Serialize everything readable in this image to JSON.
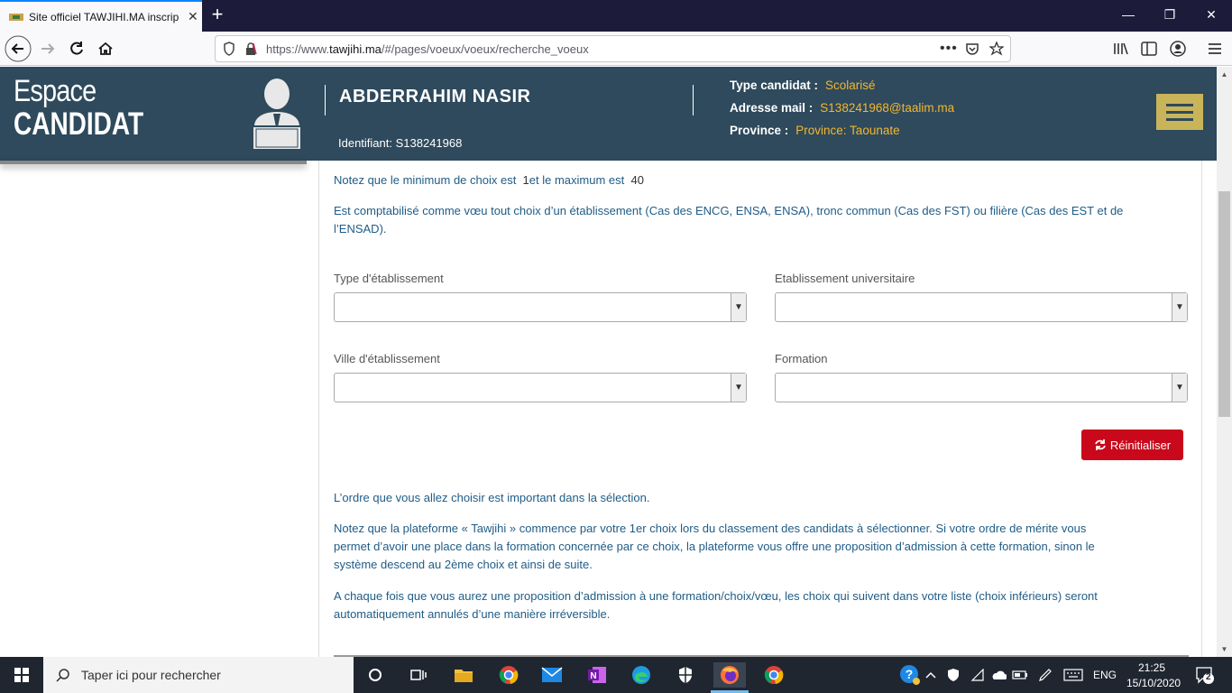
{
  "browser": {
    "tab_title": "Site officiel TAWJIHI.MA inscrip",
    "url_prefix": "https://www.",
    "url_host": "tawjihi.ma",
    "url_path": "/#/pages/voeux/voeux/recherche_voeux"
  },
  "header": {
    "brand_line1": "Espace",
    "brand_line2": "CANDIDAT",
    "candidate_name": "ABDERRAHIM NASIR",
    "identifier": "Identifiant: S138241968",
    "type_label": "Type candidat :",
    "type_value": "Scolarisé",
    "email_label": "Adresse mail :",
    "email_value": "S138241968@taalim.ma",
    "province_label": "Province :",
    "province_value": "Province: Taounate"
  },
  "content": {
    "note_min_max_prefix": "Notez que le minimum de choix est",
    "min_value": "1",
    "note_min_max_mid": "et le maximum est",
    "max_value": "40",
    "comptabilise_line1": "Est comptabilisé comme vœu tout choix d’un établissement (Cas des ENCG, ENSA, ENSA), tronc commun (Cas des FST) ou filière (Cas des EST et de",
    "comptabilise_line2": "l’ENSAD).",
    "label_type": "Type d'établissement",
    "label_etab": "Etablissement universitaire",
    "label_ville": "Ville d'établissement",
    "label_formation": "Formation",
    "reset_button": "Réinitialiser",
    "ordre": "L’ordre que vous allez choisir est important dans la sélection.",
    "plateforme_line1": "Notez que la plateforme « Tawjihi » commence par votre 1er choix lors du classement des candidats à sélectionner. Si votre ordre de mérite vous",
    "plateforme_line2": "permet d’avoir une place dans la formation concernée par ce choix, la plateforme vous offre une proposition d’admission à cette formation, sinon le",
    "plateforme_line3": "système descend au 2ème choix et ainsi de suite.",
    "chaque_line1": "A chaque fois que vous aurez une proposition d’admission à une formation/choix/vœu, les choix qui suivent dans votre liste (choix inférieurs) seront",
    "chaque_line2": "automatiquement annulés d’une manière irréversible."
  },
  "taskbar": {
    "search_placeholder": "Taper ici pour rechercher",
    "lang": "ENG",
    "time": "21:25",
    "date": "15/10/2020",
    "notif_count": "2"
  }
}
